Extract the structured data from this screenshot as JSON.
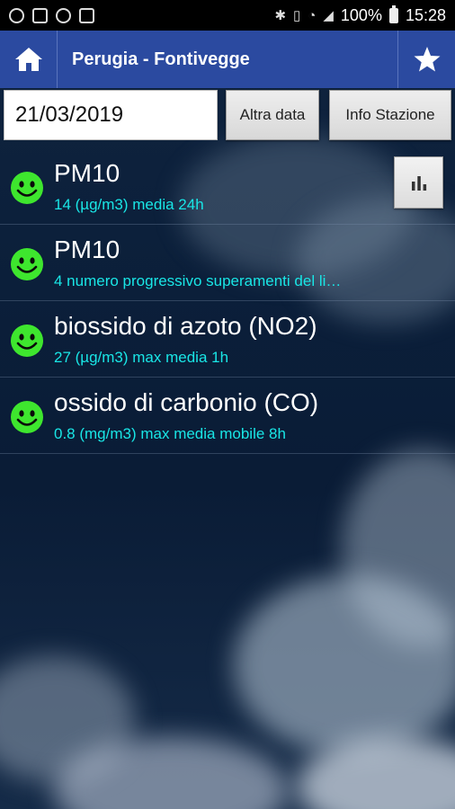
{
  "status_bar": {
    "battery": "100%",
    "time": "15:28",
    "icons": [
      "chrome-icon",
      "gallery-icon",
      "messenger-icon",
      "image-icon"
    ],
    "right_icons": [
      "bluetooth-icon",
      "vibrate-icon",
      "wifi-icon",
      "signal-icon",
      "battery-icon"
    ]
  },
  "app_bar": {
    "title": "Perugia - Fontivegge",
    "left_icon": "home-icon",
    "right_icon": "star-icon"
  },
  "controls": {
    "date": "21/03/2019",
    "altra_data": "Altra data",
    "info_stazione": "Info Stazione"
  },
  "pollutants": [
    {
      "name": "PM10",
      "detail": "14 (µg/m3)   media 24h",
      "status": "good",
      "icon": "smiley-icon"
    },
    {
      "name": "PM10",
      "detail": "4 numero progressivo superamenti del li…",
      "status": "good",
      "icon": "smiley-icon"
    },
    {
      "name": "biossido di azoto (NO2)",
      "detail": "27 (µg/m3) max media 1h",
      "status": "good",
      "icon": "smiley-icon"
    },
    {
      "name": "ossido di carbonio (CO)",
      "detail": "0.8 (mg/m3) max media mobile 8h",
      "status": "good",
      "icon": "smiley-icon"
    }
  ],
  "colors": {
    "app_bar": "#2b4aa0",
    "detail_text": "#19e6e6",
    "status_good": "#3ee62e"
  }
}
